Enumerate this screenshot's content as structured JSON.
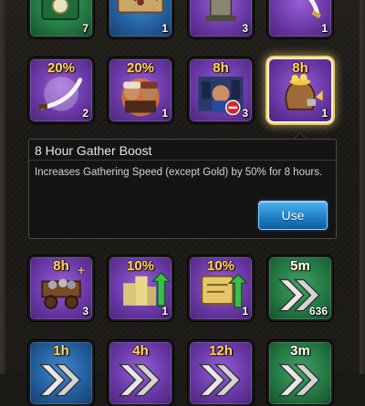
{
  "rows": [
    {
      "items": [
        {
          "name": "green-shield-chest",
          "color": "green",
          "count": "7"
        },
        {
          "name": "treasure-map",
          "color": "blue",
          "count": "1"
        },
        {
          "name": "tower-building",
          "color": "purple",
          "count": "3"
        },
        {
          "name": "curved-sword",
          "color": "purple",
          "count": "1"
        }
      ]
    },
    {
      "items": [
        {
          "name": "curved-sword-boost",
          "color": "purple",
          "badge": "20%",
          "count": "2"
        },
        {
          "name": "warriors-boost",
          "color": "purple",
          "badge": "20%",
          "count": "1"
        },
        {
          "name": "peace-shield-blocked",
          "color": "purple",
          "badge": "8h",
          "count": "3"
        },
        {
          "name": "gather-boost-sack",
          "color": "purple",
          "badge": "8h",
          "count": "1",
          "selected": true
        }
      ]
    },
    {
      "items": [
        {
          "name": "supply-cart",
          "color": "purple",
          "badge": "8h",
          "count": "3",
          "plus": "+"
        },
        {
          "name": "upkeep-boost",
          "color": "purple",
          "badge": "10%",
          "count": "1"
        },
        {
          "name": "scroll-boost",
          "color": "purple",
          "badge": "10%",
          "count": "1"
        },
        {
          "name": "speedup-arrows",
          "color": "green",
          "badge": "5m",
          "badge_color": "white",
          "count": "636"
        }
      ]
    },
    {
      "items": [
        {
          "name": "speedup-arrows",
          "color": "blue",
          "badge": "1h",
          "count": ""
        },
        {
          "name": "speedup-arrows",
          "color": "purple",
          "badge": "4h",
          "count": ""
        },
        {
          "name": "speedup-arrows",
          "color": "purple",
          "badge": "12h",
          "count": ""
        },
        {
          "name": "speedup-arrows",
          "color": "green",
          "badge": "3m",
          "badge_color": "white",
          "count": ""
        }
      ]
    }
  ],
  "detail": {
    "title": "8 Hour Gather Boost",
    "description": "Increases Gathering Speed (except Gold) by 50% for 8 hours.",
    "use_label": "Use"
  },
  "colors": {
    "gold_text": "#ffd35a",
    "use_button": "#1d7cc6",
    "panel_bg": "#141414"
  }
}
